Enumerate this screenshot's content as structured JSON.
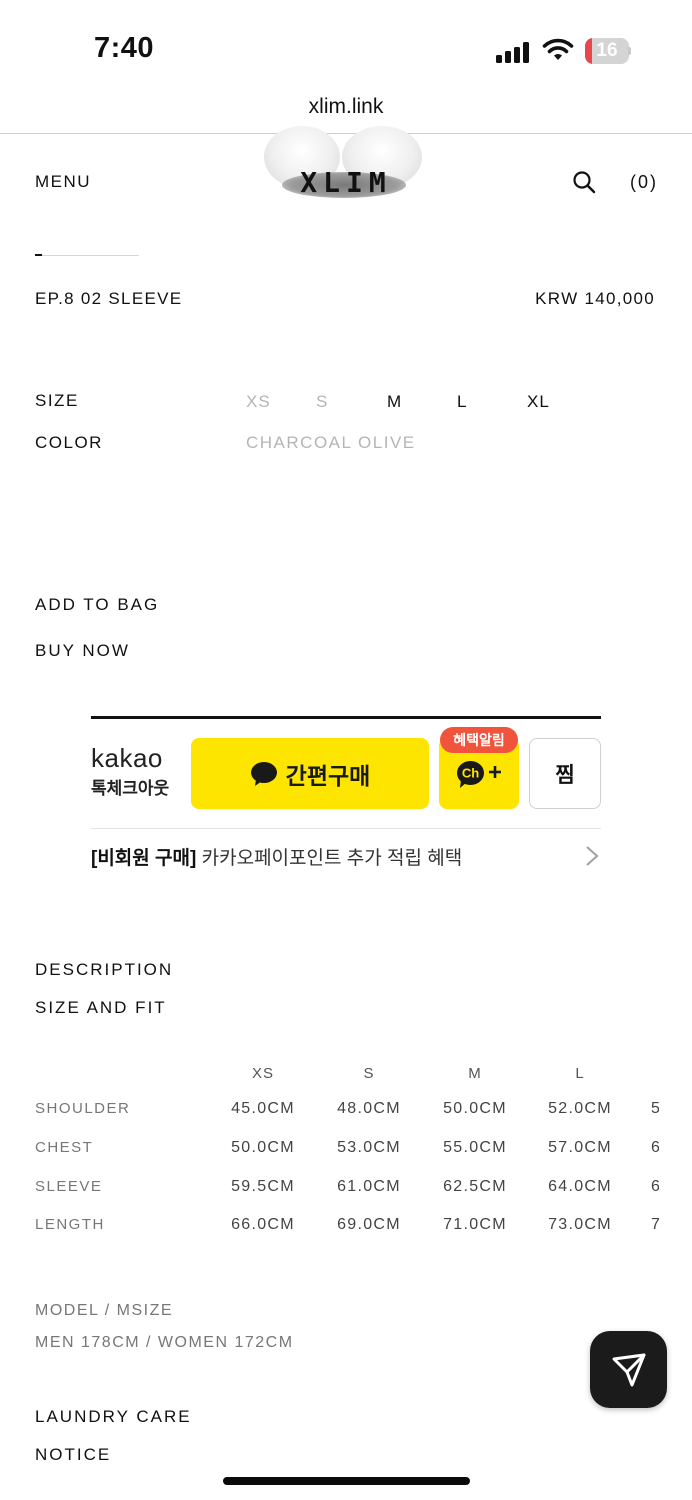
{
  "status_bar": {
    "time": "7:40",
    "battery_level": "16",
    "battery_color": "#e5484d"
  },
  "browser": {
    "url": "xlim.link"
  },
  "header": {
    "menu_label": "MENU",
    "logo": "XLIM",
    "search_icon": "search-icon",
    "cart_count": "(0)"
  },
  "product": {
    "name": "EP.8 02 SLEEVE",
    "price": "KRW 140,000",
    "size_label": "SIZE",
    "sizes": [
      {
        "label": "XS",
        "available": false
      },
      {
        "label": "S",
        "available": false
      },
      {
        "label": "M",
        "available": true
      },
      {
        "label": "L",
        "available": true
      },
      {
        "label": "XL",
        "available": true
      }
    ],
    "color_label": "COLOR",
    "color_value": "CHARCOAL OLIVE"
  },
  "actions": {
    "add_to_bag": "ADD TO BAG",
    "buy_now": "BUY NOW"
  },
  "kakao": {
    "brand": "kakao",
    "checkout_label": "톡체크아웃",
    "pay_button": "간편구매",
    "badge": "혜택알림",
    "channel_icon": "channel-plus-icon",
    "zzim_button": "찜",
    "promo_bold": "[비회원 구매]",
    "promo_text": " 카카오페이포인트 추가 적립 혜택",
    "accent_color": "#fee500"
  },
  "sections": {
    "description": "DESCRIPTION",
    "size_and_fit": "SIZE AND FIT"
  },
  "size_table": {
    "columns": [
      "XS",
      "S",
      "M",
      "L"
    ],
    "rows": [
      {
        "label": "SHOULDER",
        "values": [
          "45.0CM",
          "48.0CM",
          "50.0CM",
          "52.0CM"
        ],
        "clipped": "5"
      },
      {
        "label": "CHEST",
        "values": [
          "50.0CM",
          "53.0CM",
          "55.0CM",
          "57.0CM"
        ],
        "clipped": "6"
      },
      {
        "label": "SLEEVE",
        "values": [
          "59.5CM",
          "61.0CM",
          "62.5CM",
          "64.0CM"
        ],
        "clipped": "6"
      },
      {
        "label": "LENGTH",
        "values": [
          "66.0CM",
          "69.0CM",
          "71.0CM",
          "73.0CM"
        ],
        "clipped": "7"
      }
    ]
  },
  "model": {
    "label": "MODEL / MSIZE",
    "value": "MEN 178CM / WOMEN 172CM"
  },
  "footer_sections": {
    "laundry_care": "LAUNDRY CARE",
    "notice": "NOTICE"
  },
  "fab_icon": "send-icon"
}
